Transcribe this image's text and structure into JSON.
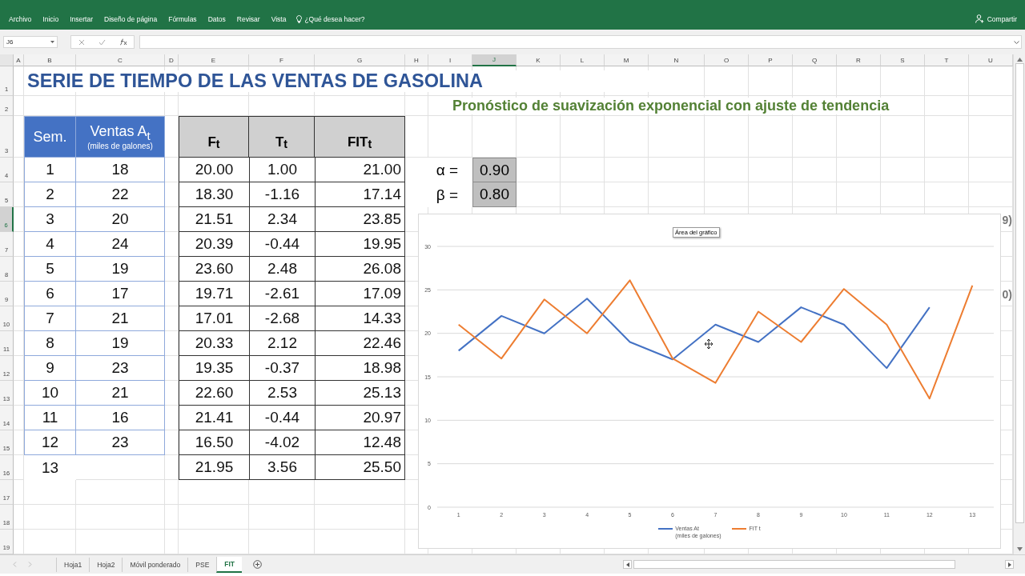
{
  "ribbon": {
    "tabs": [
      {
        "label": "Archivo"
      },
      {
        "label": "Inicio"
      },
      {
        "label": "Insertar"
      },
      {
        "label": "Diseño de página"
      },
      {
        "label": "Fórmulas"
      },
      {
        "label": "Datos"
      },
      {
        "label": "Revisar"
      },
      {
        "label": "Vista"
      }
    ],
    "tell_me": "¿Qué desea hacer?",
    "share": "Compartir"
  },
  "formula_bar": {
    "name_box": "J6"
  },
  "columns": [
    {
      "label": "A",
      "selected": false
    },
    {
      "label": "B",
      "selected": false
    },
    {
      "label": "C",
      "selected": false
    },
    {
      "label": "D",
      "selected": false
    },
    {
      "label": "E",
      "selected": false
    },
    {
      "label": "F",
      "selected": false
    },
    {
      "label": "G",
      "selected": false
    },
    {
      "label": "H",
      "selected": false
    },
    {
      "label": "I",
      "selected": false
    },
    {
      "label": "J",
      "selected": true
    },
    {
      "label": "K",
      "selected": false
    },
    {
      "label": "L",
      "selected": false
    },
    {
      "label": "M",
      "selected": false
    },
    {
      "label": "N",
      "selected": false
    },
    {
      "label": "O",
      "selected": false
    },
    {
      "label": "P",
      "selected": false
    },
    {
      "label": "Q",
      "selected": false
    },
    {
      "label": "R",
      "selected": false
    },
    {
      "label": "S",
      "selected": false
    },
    {
      "label": "T",
      "selected": false
    },
    {
      "label": "U",
      "selected": false
    }
  ],
  "rows": [
    {
      "label": "1",
      "selected": false
    },
    {
      "label": "2",
      "selected": false
    },
    {
      "label": "3",
      "selected": false
    },
    {
      "label": "4",
      "selected": false
    },
    {
      "label": "5",
      "selected": false
    },
    {
      "label": "6",
      "selected": true
    },
    {
      "label": "7",
      "selected": false
    },
    {
      "label": "8",
      "selected": false
    },
    {
      "label": "9",
      "selected": false
    },
    {
      "label": "10",
      "selected": false
    },
    {
      "label": "11",
      "selected": false
    },
    {
      "label": "12",
      "selected": false
    },
    {
      "label": "13",
      "selected": false
    },
    {
      "label": "14",
      "selected": false
    },
    {
      "label": "15",
      "selected": false
    },
    {
      "label": "16",
      "selected": false
    },
    {
      "label": "17",
      "selected": false
    },
    {
      "label": "18",
      "selected": false
    },
    {
      "label": "19",
      "selected": false
    }
  ],
  "title": "SERIE DE TIEMPO DE LAS VENTAS DE GASOLINA",
  "subtitle": "Pronóstico de suavización exponencial con ajuste de tendencia",
  "sales_table": {
    "week_header": "Sem.",
    "sales_header": "Ventas A$_{t}$",
    "unit": "(miles de galones)",
    "rows": [
      {
        "week": "1",
        "sales": "18"
      },
      {
        "week": "2",
        "sales": "22"
      },
      {
        "week": "3",
        "sales": "20"
      },
      {
        "week": "4",
        "sales": "24"
      },
      {
        "week": "5",
        "sales": "19"
      },
      {
        "week": "6",
        "sales": "17"
      },
      {
        "week": "7",
        "sales": "21"
      },
      {
        "week": "8",
        "sales": "19"
      },
      {
        "week": "9",
        "sales": "23"
      },
      {
        "week": "10",
        "sales": "21"
      },
      {
        "week": "11",
        "sales": "16"
      },
      {
        "week": "12",
        "sales": "23"
      },
      {
        "week": "13"
      }
    ]
  },
  "forecast_table": {
    "headers": [
      "F$_{t}$",
      "T$_{t}$",
      "FIT$_{t}$"
    ],
    "rows": [
      [
        "20.00",
        "1.00",
        "21.00"
      ],
      [
        "18.30",
        "-1.16",
        "17.14"
      ],
      [
        "21.51",
        "2.34",
        "23.85"
      ],
      [
        "20.39",
        "-0.44",
        "19.95"
      ],
      [
        "23.60",
        "2.48",
        "26.08"
      ],
      [
        "19.71",
        "-2.61",
        "17.09"
      ],
      [
        "17.01",
        "-2.68",
        "14.33"
      ],
      [
        "20.33",
        "2.12",
        "22.46"
      ],
      [
        "19.35",
        "-0.37",
        "18.98"
      ],
      [
        "22.60",
        "2.53",
        "25.13"
      ],
      [
        "21.41",
        "-0.44",
        "20.97"
      ],
      [
        "16.50",
        "-4.02",
        "12.48"
      ],
      [
        "21.95",
        "3.56",
        "25.50"
      ]
    ]
  },
  "parameters": [
    {
      "label": "α =",
      "value": "0.90"
    },
    {
      "label": "β =",
      "value": "0.80"
    }
  ],
  "clipped_texts": [
    "9)",
    "0)"
  ],
  "chart": {
    "tooltip": "Área del gráfico",
    "chart_data": {
      "type": "line",
      "grid": true,
      "legend": true,
      "categories": [
        "1",
        "2",
        "3",
        "4",
        "5",
        "6",
        "7",
        "8",
        "9",
        "10",
        "11",
        "12",
        "13"
      ],
      "ylim": [
        0,
        30
      ],
      "yticks": [
        0,
        5,
        10,
        15,
        20,
        25,
        30
      ],
      "series": [
        {
          "name": "Ventas At\n(miles de galones)",
          "color": "#4472c4",
          "values": [
            18,
            22,
            20,
            24,
            19,
            17,
            21,
            19,
            23,
            21,
            16,
            23,
            null
          ]
        },
        {
          "name": "FIT t",
          "color": "#ed7d31",
          "values": [
            21,
            17.1,
            23.9,
            20,
            26.1,
            17.1,
            14.3,
            22.5,
            19,
            25.1,
            21,
            12.5,
            25.5
          ]
        }
      ]
    }
  },
  "sheet_tabs": [
    {
      "label": "Hoja1",
      "selected": false
    },
    {
      "label": "Hoja2",
      "selected": false
    },
    {
      "label": "Móvil ponderado",
      "selected": false
    },
    {
      "label": "PSE",
      "selected": false
    },
    {
      "label": "FIT",
      "selected": true
    }
  ]
}
